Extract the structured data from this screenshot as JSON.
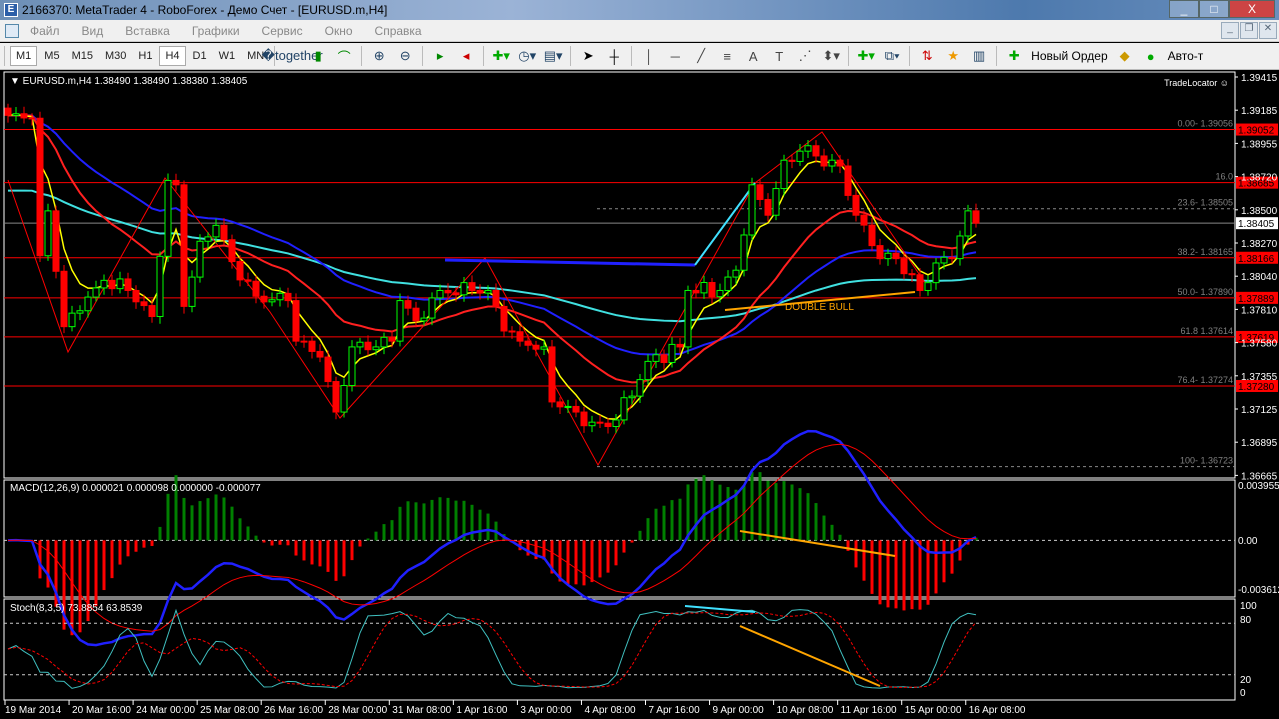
{
  "window": {
    "title": "2166370: MetaTrader 4 - RoboForex - Демо Счет - [EURUSD.m,H4]",
    "minimize": "_",
    "maximize": "□",
    "close": "X"
  },
  "menu": [
    "Файл",
    "Вид",
    "Вставка",
    "Графики",
    "Сервис",
    "Окно",
    "Справка"
  ],
  "timeframes": [
    "M1",
    "M5",
    "M15",
    "M30",
    "H1",
    "H4",
    "D1",
    "W1",
    "MN"
  ],
  "active_timeframe": "H4",
  "toolbar": {
    "new_order": "Новый Ордер",
    "auto_trading": "Авто-т"
  },
  "chart": {
    "symbol_info": "EURUSD.m,H4  1.38490 1.38490 1.38380 1.38405",
    "tradelocator": "TradeLocator ☺",
    "price_axis": [
      "1.39415",
      "1.39185",
      "1.38955",
      "1.38720",
      "1.38500",
      "1.38270",
      "1.38040",
      "1.37810",
      "1.37580",
      "1.37355",
      "1.37125",
      "1.36895",
      "1.36665"
    ],
    "current_price": "1.38405",
    "levels": [
      {
        "price": 1.39052,
        "label": "1.39052",
        "fib": "0.00- 1.39056"
      },
      {
        "price": 1.38685,
        "label": "1.38685",
        "fib": "16.0"
      },
      {
        "price": 1.38166,
        "label": "1.38166",
        "fib": "38.2- 1.38165"
      },
      {
        "price": 1.37889,
        "label": "1.37889",
        "fib": "50.0- 1.37890"
      },
      {
        "price": 1.37619,
        "label": "1.37619",
        "fib": "61.8 1.37614"
      },
      {
        "price": 1.3728,
        "label": "1.37280",
        "fib": "76.4- 1.37274"
      }
    ],
    "dashed_levels": [
      {
        "price": 1.38505,
        "fib": "23.6- 1.38505"
      },
      {
        "price": 1.36723,
        "fib": "100- 1.36723"
      }
    ],
    "annotation": "DOUBLE BULL",
    "colors": {
      "bull": "#00ff00",
      "bear": "#ff0000",
      "level": "#ff0000",
      "fast_ma": "#ffff00",
      "mid_ma": "#ff2020",
      "slow_ma": "#2020ff",
      "long_ma": "#40e0e0",
      "fib": "#808080",
      "annotation": "#ffa500"
    }
  },
  "chart_data": {
    "type": "candlestick",
    "symbol": "EURUSD.m",
    "timeframe": "H4",
    "keypoints": [
      [
        0,
        1.3915
      ],
      [
        3,
        1.3913
      ],
      [
        4,
        1.3818
      ],
      [
        5,
        1.3849
      ],
      [
        7,
        1.3769
      ],
      [
        9,
        1.378
      ],
      [
        12,
        1.3801
      ],
      [
        15,
        1.3794
      ],
      [
        18,
        1.3776
      ],
      [
        20,
        1.387
      ],
      [
        21,
        1.3867
      ],
      [
        22,
        1.3783
      ],
      [
        24,
        1.3828
      ],
      [
        26,
        1.3839
      ],
      [
        28,
        1.3814
      ],
      [
        31,
        1.379
      ],
      [
        35,
        1.3787
      ],
      [
        36,
        1.3759
      ],
      [
        39,
        1.3748
      ],
      [
        41,
        1.371
      ],
      [
        43,
        1.3755
      ],
      [
        46,
        1.3755
      ],
      [
        48,
        1.3759
      ],
      [
        49,
        1.3787
      ],
      [
        51,
        1.3773
      ],
      [
        54,
        1.3794
      ],
      [
        58,
        1.3794
      ],
      [
        60,
        1.3794
      ],
      [
        62,
        1.3766
      ],
      [
        64,
        1.3759
      ],
      [
        67,
        1.3755
      ],
      [
        68,
        1.3717
      ],
      [
        71,
        1.371
      ],
      [
        73,
        1.3703
      ],
      [
        75,
        1.37
      ],
      [
        78,
        1.3721
      ],
      [
        80,
        1.3745
      ],
      [
        84,
        1.3755
      ],
      [
        85,
        1.3794
      ],
      [
        89,
        1.3794
      ],
      [
        91,
        1.3808
      ],
      [
        93,
        1.3867
      ],
      [
        95,
        1.3846
      ],
      [
        97,
        1.3884
      ],
      [
        100,
        1.3894
      ],
      [
        102,
        1.388
      ],
      [
        104,
        1.388
      ],
      [
        106,
        1.3846
      ],
      [
        108,
        1.3825
      ],
      [
        109,
        1.3816
      ],
      [
        111,
        1.3816
      ],
      [
        114,
        1.3794
      ],
      [
        116,
        1.3813
      ],
      [
        118,
        1.3816
      ],
      [
        120,
        1.3849
      ],
      [
        121,
        1.38405
      ]
    ],
    "ylim": [
      1.36665,
      1.39415
    ],
    "x_labels": [
      "19 Mar 2014",
      "20 Mar 16:00",
      "24 Mar 00:00",
      "25 Mar 08:00",
      "26 Mar 16:00",
      "28 Mar 00:00",
      "31 Mar 08:00",
      "1 Apr 16:00",
      "3 Apr 00:00",
      "4 Apr 08:00",
      "7 Apr 16:00",
      "9 Apr 00:00",
      "10 Apr 08:00",
      "11 Apr 16:00",
      "15 Apr 00:00",
      "16 Apr 08:00"
    ],
    "macd": {
      "label": "MACD(12,26,9) 0.000021 0.000098 0.000000 -0.000077",
      "axis": [
        "0.003955",
        "0.00",
        "-0.003612"
      ],
      "ylim": [
        -0.003612,
        0.003955
      ]
    },
    "stoch": {
      "label": "Stoch(8,3,5) 73.8854 63.8539",
      "axis": [
        "100",
        "80",
        "20",
        "0"
      ],
      "ylim": [
        0,
        100
      ]
    }
  }
}
